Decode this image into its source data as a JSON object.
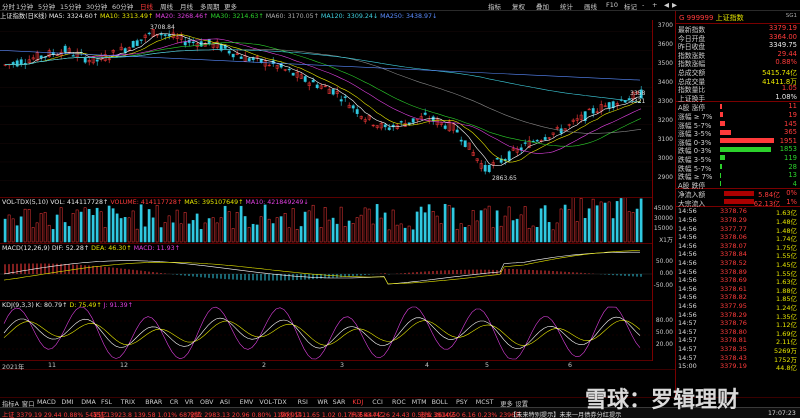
{
  "topbar": {
    "periods": [
      "分时",
      "1分钟",
      "5分钟",
      "15分钟",
      "30分钟",
      "60分钟",
      "日线",
      "周线",
      "月线",
      "多周期",
      "更多"
    ],
    "periods_active_index": 6,
    "menu": [
      "指标",
      "复权",
      "叠加",
      "统计",
      "画线",
      "F10",
      "标记",
      "-",
      "+"
    ],
    "left_buttons": [
      "◀",
      "▶"
    ]
  },
  "ma_line": {
    "name": "上证指数(日K线)",
    "ma5": "MA5: 3324.60↑",
    "ma10": "MA10: 3313.49↑",
    "ma20": "MA20: 3268.46↑",
    "ma30": "MA30: 3214.63↑",
    "ma60": "MA60: 3170.05↑",
    "ma120": "MA120: 3309.24↓",
    "ma250": "MA250: 3438.97↓"
  },
  "price_axis": [
    "3700",
    "3600",
    "3500",
    "3400",
    "3300",
    "3200",
    "3100",
    "3000",
    "2900"
  ],
  "price_annot": {
    "high": "3708.84",
    "low": "2863.65",
    "last1": "3358",
    "last2": "3321"
  },
  "volume": {
    "title": "VOL-TDX(5,10)",
    "vol": "VOL: 414117728↑",
    "volume_label": "VOLUME: 414117728↑",
    "ma5": "MA5: 395107649↑",
    "ma10": "MA10: 421849249↓",
    "axis": [
      "45000",
      "30000",
      "15000"
    ],
    "unit": "X1万"
  },
  "macd": {
    "title": "MACD(12,26,9)",
    "dif": "DIF: 52.28↑",
    "dea": "DEA: 46.30↑",
    "macd": "MACD: 11.93↑",
    "axis": [
      "50.00",
      "0.00",
      "-50.00"
    ]
  },
  "kdj": {
    "title": "KDJ(9,3,3)",
    "k": "K: 80.79↑",
    "d": "D: 75.49↑",
    "j": "J: 91.39↑",
    "axis": [
      "80.00",
      "50.00",
      "20.00"
    ]
  },
  "xaxis": [
    "2021年",
    "11",
    "12",
    "2",
    "3",
    "4",
    "5",
    "6"
  ],
  "right_panel": {
    "code": "999999",
    "name": "上证指数",
    "tag": "SG1",
    "rows": [
      {
        "label": "最新指数",
        "value": "3379.19",
        "color": "red"
      },
      {
        "label": "今日开盘",
        "value": "3364.00",
        "color": "red"
      },
      {
        "label": "昨日收盘",
        "value": "3349.75",
        "color": "white"
      },
      {
        "label": "指数涨跌",
        "value": "29.44",
        "color": "red"
      },
      {
        "label": "指数涨幅",
        "value": "0.88%",
        "color": "red"
      },
      {
        "label": "总成交额",
        "value": "5415.74亿",
        "color": "yellow"
      },
      {
        "label": "总成交量",
        "value": "41411.8万",
        "color": "yellow"
      },
      {
        "label": "指数量比",
        "value": "1.05",
        "color": "red"
      },
      {
        "label": "上证换手",
        "value": "1.08%",
        "color": "white"
      }
    ],
    "dist": [
      {
        "label": "A股 涨停",
        "value": "11",
        "color": "red",
        "bar": 0.04
      },
      {
        "label": "涨幅 ≥ 7%",
        "value": "19",
        "color": "red",
        "bar": 0.06
      },
      {
        "label": "涨幅 5-7%",
        "value": "145",
        "color": "red",
        "bar": 0.1
      },
      {
        "label": "涨幅 3-5%",
        "value": "365",
        "color": "red",
        "bar": 0.2
      },
      {
        "label": "涨幅 0-3%",
        "value": "1951",
        "color": "red",
        "bar": 1.0
      },
      {
        "label": "跌幅 0-3%",
        "value": "1853",
        "color": "green",
        "bar": 0.95
      },
      {
        "label": "跌幅 3-5%",
        "value": "119",
        "color": "green",
        "bar": 0.1
      },
      {
        "label": "跌幅 5-7%",
        "value": "28",
        "color": "green",
        "bar": 0.03
      },
      {
        "label": "跌幅 ≥ 7%",
        "value": "13",
        "color": "green",
        "bar": 0.02
      },
      {
        "label": "A股 跌停",
        "value": "4",
        "color": "green",
        "bar": 0.01
      }
    ],
    "flow": [
      {
        "label": "净流入额",
        "value": "5.84亿",
        "pct": "0%",
        "color": "red"
      },
      {
        "label": "大宗流入",
        "value": "62.13亿",
        "pct": "1%",
        "color": "red"
      }
    ],
    "ticks": [
      {
        "t": "14:56",
        "p": "3378.76",
        "v": "1.63亿"
      },
      {
        "t": "14:56",
        "p": "3378.29",
        "v": "1.48亿"
      },
      {
        "t": "14:56",
        "p": "3377.77",
        "v": "1.48亿"
      },
      {
        "t": "14:56",
        "p": "3378.06",
        "v": "1.74亿"
      },
      {
        "t": "14:56",
        "p": "3378.07",
        "v": "1.75亿"
      },
      {
        "t": "14:56",
        "p": "3378.84",
        "v": "1.55亿"
      },
      {
        "t": "14:56",
        "p": "3378.52",
        "v": "1.45亿"
      },
      {
        "t": "14:56",
        "p": "3378.89",
        "v": "1.55亿"
      },
      {
        "t": "14:56",
        "p": "3378.69",
        "v": "1.63亿"
      },
      {
        "t": "14:56",
        "p": "3378.61",
        "v": "1.88亿"
      },
      {
        "t": "14:56",
        "p": "3378.82",
        "v": "1.85亿"
      },
      {
        "t": "14:56",
        "p": "3377.95",
        "v": "1.24亿"
      },
      {
        "t": "14:56",
        "p": "3378.29",
        "v": "1.35亿"
      },
      {
        "t": "14:57",
        "p": "3378.76",
        "v": "1.12亿"
      },
      {
        "t": "14:57",
        "p": "3378.80",
        "v": "1.69亿"
      },
      {
        "t": "14:57",
        "p": "3378.81",
        "v": "2.11亿"
      },
      {
        "t": "14:57",
        "p": "3378.35",
        "v": "5269万"
      },
      {
        "t": "14:57",
        "p": "3378.43",
        "v": "1752万"
      },
      {
        "t": "15:00",
        "p": "3379.19",
        "v": "44.8亿"
      }
    ]
  },
  "bottom_tabs": [
    "指标A",
    "窗口",
    "MACD",
    "DMI",
    "DMA",
    "FSL",
    "TRIX",
    "BRAR",
    "CR",
    "VR",
    "OBV",
    "ASI",
    "EMV",
    "VOL-TDX",
    "RSI",
    "WR",
    "SAR",
    "KDJ",
    "CCI",
    "ROC",
    "MTM",
    "BOLL",
    "PSY",
    "MCST",
    "更多",
    "设置"
  ],
  "bottom_tabs_active": "KDJ",
  "left_subtabs": [
    "主力",
    "交易查询",
    "市场资讯",
    "板块资讯"
  ],
  "statusbar": {
    "sh": "上证 3379.19 29.44 0.88% 5415亿",
    "sz": "深证 13923.8 139.58 1.01% 6872亿",
    "cy": "创业 2983.13 20.96 0.80% 1120.9亿",
    "kc": "科创 1411.65 1.02 0.17% 583.7亿",
    "hs": "沪深 4444.26 24.43 0.55% 3814亿",
    "zz": "创业 2610.60 6.16 0.23% 2396亿",
    "notice": "【未来特别提示】未来一月债券分红提示",
    "time": "17:07:23"
  },
  "watermark": "雪球：罗辑理财",
  "colors": {
    "up": "#ff3b3b",
    "down": "#2bd02b",
    "ma5": "#ffffff",
    "ma10": "#e6e600",
    "ma20": "#e040e0",
    "ma30": "#2bd02b",
    "ma60": "#888888",
    "ma120": "#3fd0e0",
    "ma250": "#5a8cff"
  }
}
